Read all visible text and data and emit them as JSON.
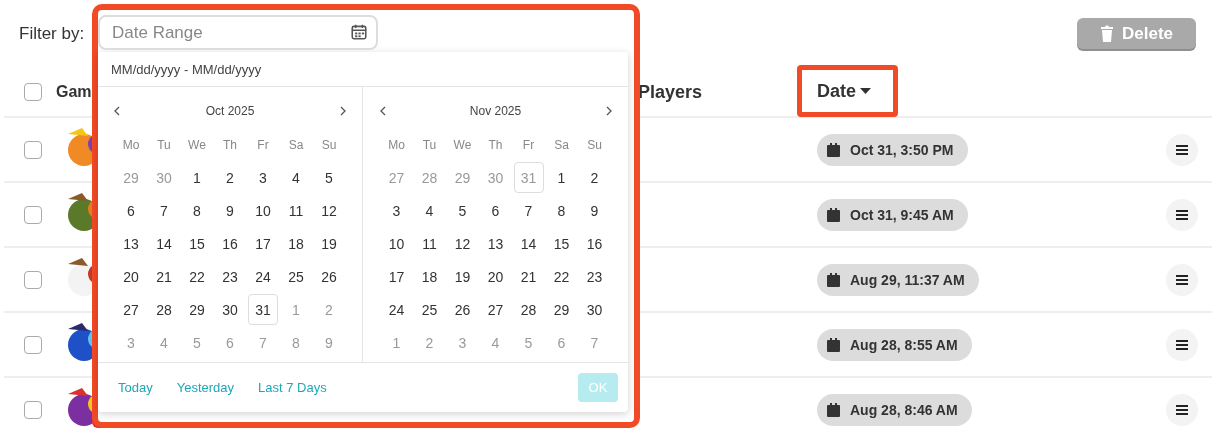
{
  "filter_label": "Filter by:",
  "date_field": {
    "placeholder": "Date Range"
  },
  "delete_button": {
    "label": "Delete",
    "disabled": true
  },
  "table": {
    "select_all": {
      "checked": false
    },
    "columns": [
      {
        "label": "Gam"
      },
      {
        "label": "Players"
      },
      {
        "label": "Date",
        "sorted": true
      }
    ],
    "rows": [
      {
        "checked": false,
        "date": "Oct 31, 3:50 PM"
      },
      {
        "checked": false,
        "date": "Oct 31, 9:45 AM"
      },
      {
        "checked": false,
        "date": "Aug 29, 11:37 AM"
      },
      {
        "checked": false,
        "date": "Aug 28, 8:55 AM"
      },
      {
        "checked": false,
        "date": "Aug 28, 8:46 AM"
      }
    ]
  },
  "picker": {
    "format_hint": "MM/dd/yyyy - MM/dd/yyyy",
    "months": [
      {
        "title": "Oct 2025",
        "weekdays": [
          "Mo",
          "Tu",
          "We",
          "Th",
          "Fr",
          "Sa",
          "Su"
        ],
        "weeks": [
          [
            {
              "d": "29",
              "muted": true,
              "today": false
            },
            {
              "d": "30",
              "muted": true,
              "today": false
            },
            {
              "d": "1",
              "muted": false,
              "today": false
            },
            {
              "d": "2",
              "muted": false,
              "today": false
            },
            {
              "d": "3",
              "muted": false,
              "today": false
            },
            {
              "d": "4",
              "muted": false,
              "today": false
            },
            {
              "d": "5",
              "muted": false,
              "today": false
            }
          ],
          [
            {
              "d": "6",
              "muted": false,
              "today": false
            },
            {
              "d": "7",
              "muted": false,
              "today": false
            },
            {
              "d": "8",
              "muted": false,
              "today": false
            },
            {
              "d": "9",
              "muted": false,
              "today": false
            },
            {
              "d": "10",
              "muted": false,
              "today": false
            },
            {
              "d": "11",
              "muted": false,
              "today": false
            },
            {
              "d": "12",
              "muted": false,
              "today": false
            }
          ],
          [
            {
              "d": "13",
              "muted": false,
              "today": false
            },
            {
              "d": "14",
              "muted": false,
              "today": false
            },
            {
              "d": "15",
              "muted": false,
              "today": false
            },
            {
              "d": "16",
              "muted": false,
              "today": false
            },
            {
              "d": "17",
              "muted": false,
              "today": false
            },
            {
              "d": "18",
              "muted": false,
              "today": false
            },
            {
              "d": "19",
              "muted": false,
              "today": false
            }
          ],
          [
            {
              "d": "20",
              "muted": false,
              "today": false
            },
            {
              "d": "21",
              "muted": false,
              "today": false
            },
            {
              "d": "22",
              "muted": false,
              "today": false
            },
            {
              "d": "23",
              "muted": false,
              "today": false
            },
            {
              "d": "24",
              "muted": false,
              "today": false
            },
            {
              "d": "25",
              "muted": false,
              "today": false
            },
            {
              "d": "26",
              "muted": false,
              "today": false
            }
          ],
          [
            {
              "d": "27",
              "muted": false,
              "today": false
            },
            {
              "d": "28",
              "muted": false,
              "today": false
            },
            {
              "d": "29",
              "muted": false,
              "today": false
            },
            {
              "d": "30",
              "muted": false,
              "today": false
            },
            {
              "d": "31",
              "muted": false,
              "today": true
            },
            {
              "d": "1",
              "muted": true,
              "today": false
            },
            {
              "d": "2",
              "muted": true,
              "today": false
            }
          ],
          [
            {
              "d": "3",
              "muted": true,
              "today": false
            },
            {
              "d": "4",
              "muted": true,
              "today": false
            },
            {
              "d": "5",
              "muted": true,
              "today": false
            },
            {
              "d": "6",
              "muted": true,
              "today": false
            },
            {
              "d": "7",
              "muted": true,
              "today": false
            },
            {
              "d": "8",
              "muted": true,
              "today": false
            },
            {
              "d": "9",
              "muted": true,
              "today": false
            }
          ]
        ]
      },
      {
        "title": "Nov 2025",
        "weekdays": [
          "Mo",
          "Tu",
          "We",
          "Th",
          "Fr",
          "Sa",
          "Su"
        ],
        "weeks": [
          [
            {
              "d": "27",
              "muted": true,
              "today": false
            },
            {
              "d": "28",
              "muted": true,
              "today": false
            },
            {
              "d": "29",
              "muted": true,
              "today": false
            },
            {
              "d": "30",
              "muted": true,
              "today": false
            },
            {
              "d": "31",
              "muted": true,
              "today": true
            },
            {
              "d": "1",
              "muted": false,
              "today": false
            },
            {
              "d": "2",
              "muted": false,
              "today": false
            }
          ],
          [
            {
              "d": "3",
              "muted": false,
              "today": false
            },
            {
              "d": "4",
              "muted": false,
              "today": false
            },
            {
              "d": "5",
              "muted": false,
              "today": false
            },
            {
              "d": "6",
              "muted": false,
              "today": false
            },
            {
              "d": "7",
              "muted": false,
              "today": false
            },
            {
              "d": "8",
              "muted": false,
              "today": false
            },
            {
              "d": "9",
              "muted": false,
              "today": false
            }
          ],
          [
            {
              "d": "10",
              "muted": false,
              "today": false
            },
            {
              "d": "11",
              "muted": false,
              "today": false
            },
            {
              "d": "12",
              "muted": false,
              "today": false
            },
            {
              "d": "13",
              "muted": false,
              "today": false
            },
            {
              "d": "14",
              "muted": false,
              "today": false
            },
            {
              "d": "15",
              "muted": false,
              "today": false
            },
            {
              "d": "16",
              "muted": false,
              "today": false
            }
          ],
          [
            {
              "d": "17",
              "muted": false,
              "today": false
            },
            {
              "d": "18",
              "muted": false,
              "today": false
            },
            {
              "d": "19",
              "muted": false,
              "today": false
            },
            {
              "d": "20",
              "muted": false,
              "today": false
            },
            {
              "d": "21",
              "muted": false,
              "today": false
            },
            {
              "d": "22",
              "muted": false,
              "today": false
            },
            {
              "d": "23",
              "muted": false,
              "today": false
            }
          ],
          [
            {
              "d": "24",
              "muted": false,
              "today": false
            },
            {
              "d": "25",
              "muted": false,
              "today": false
            },
            {
              "d": "26",
              "muted": false,
              "today": false
            },
            {
              "d": "27",
              "muted": false,
              "today": false
            },
            {
              "d": "28",
              "muted": false,
              "today": false
            },
            {
              "d": "29",
              "muted": false,
              "today": false
            },
            {
              "d": "30",
              "muted": false,
              "today": false
            }
          ],
          [
            {
              "d": "1",
              "muted": true,
              "today": false
            },
            {
              "d": "2",
              "muted": true,
              "today": false
            },
            {
              "d": "3",
              "muted": true,
              "today": false
            },
            {
              "d": "4",
              "muted": true,
              "today": false
            },
            {
              "d": "5",
              "muted": true,
              "today": false
            },
            {
              "d": "6",
              "muted": true,
              "today": false
            },
            {
              "d": "7",
              "muted": true,
              "today": false
            }
          ]
        ]
      }
    ],
    "shortcuts": [
      "Today",
      "Yesterday",
      "Last 7 Days"
    ],
    "ok_button": {
      "label": "OK",
      "disabled": true
    }
  }
}
